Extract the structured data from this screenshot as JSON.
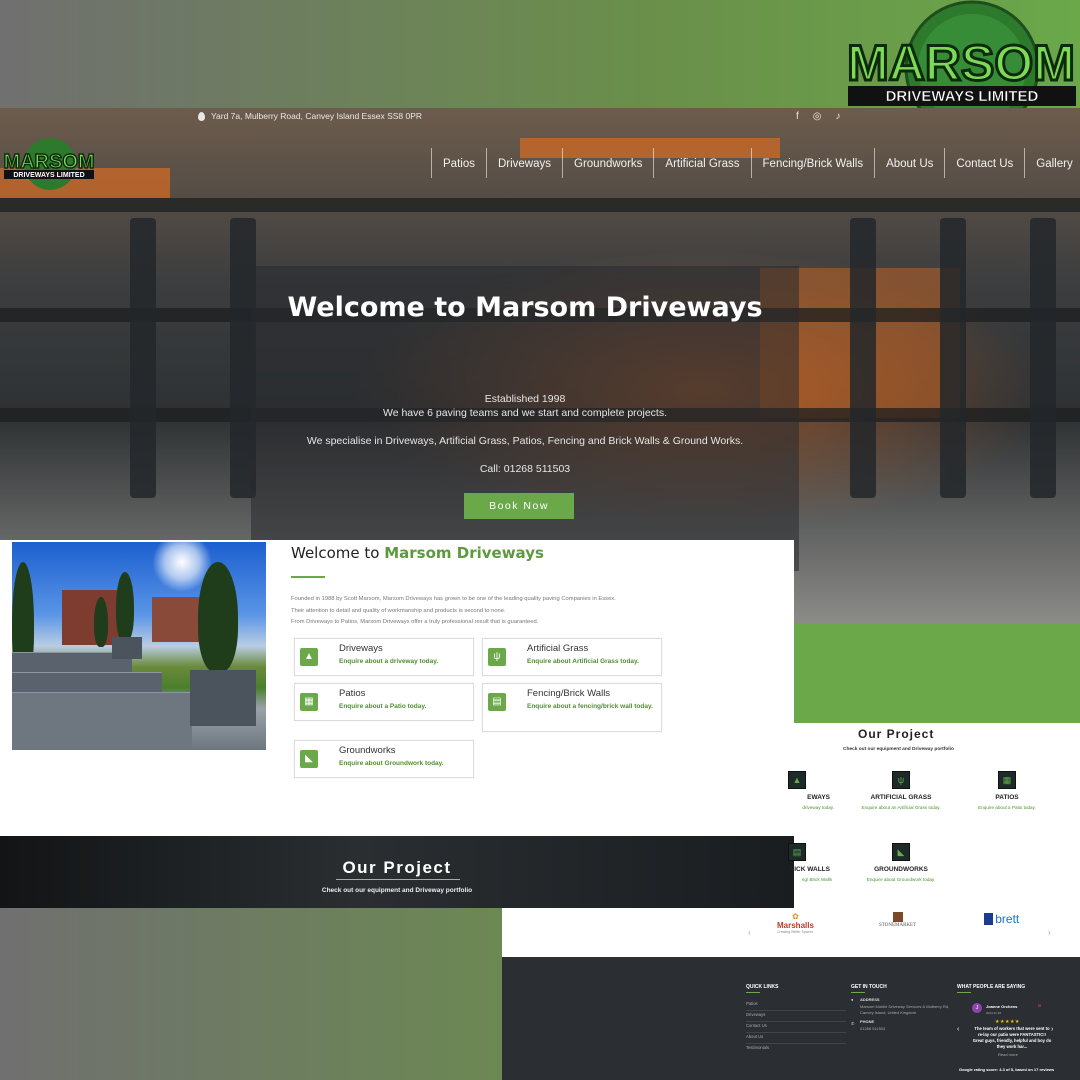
{
  "brand": {
    "name": "MARSOM",
    "tagline": "DRIVEWAYS LIMITED"
  },
  "hero": {
    "address": "Yard 7a, Mulberry Road, Canvey Island Essex SS8 0PR",
    "socials": [
      "f",
      "◎",
      "♪"
    ],
    "nav": [
      "Patios",
      "Driveways",
      "Groundworks",
      "Artificial Grass",
      "Fencing/Brick Walls",
      "About Us",
      "Contact Us",
      "Gallery"
    ],
    "title": "Welcome to Marsom Driveways",
    "established": "Established 1998",
    "teams": "We have 6 paving teams and we start and complete projects.",
    "specialise": "We specialise in Driveways, Artificial Grass, Patios, Fencing and Brick Walls & Ground Works.",
    "call": "Call: 01268 511503",
    "book_label": "Book Now"
  },
  "about": {
    "title_prefix": "Welcome to ",
    "title_highlight": "Marsom Driveways",
    "p1": "Founded in 1988 by Scott Marsom, Marsom Driveways has grown to be one of the leading quality paving Companies in Essex.",
    "p2": "Their attention to detail and quality of workmanship and products is second to none.",
    "p3": "From Driveways to Patios, Marsom Driveways offer a truly professional result that is guaranteed.",
    "services": [
      {
        "title": "Driveways",
        "sub": "Enquire about a driveway today.",
        "icon": "driveway-icon"
      },
      {
        "title": "Artificial Grass",
        "sub": "Enquire about Artificial Grass today.",
        "icon": "grass-icon"
      },
      {
        "title": "Patios",
        "sub": "Enquire about a Patio today.",
        "icon": "patio-icon"
      },
      {
        "title": "Fencing/Brick Walls",
        "sub": "Enquire about a fencing/brick wall today.",
        "icon": "brick-wall-icon"
      },
      {
        "title": "Groundworks",
        "sub": "Enquire about Groundwork today.",
        "icon": "groundworks-icon"
      }
    ]
  },
  "project_banner": {
    "title": "Our Project",
    "sub": "Check out our equipment and Driveway portfolio"
  },
  "project_panel": {
    "title": "Our Project",
    "sub": "Check out our equipment and Driveway portfolio",
    "items": [
      {
        "title": "EWAYS",
        "sub": "driveway today."
      },
      {
        "title": "ARTIFICIAL GRASS",
        "sub": "Enquire about an Artificial Grass today."
      },
      {
        "title": "PATIOS",
        "sub": "Enquire about a Patio today."
      },
      {
        "title": "RICK WALLS",
        "sub": "ng/ Brick Walls"
      },
      {
        "title": "GROUNDWORKS",
        "sub": "Enquire about Groundwork today."
      }
    ],
    "brands": [
      "Marshalls",
      "STONEMARKET",
      "brett"
    ],
    "marshalls_tagline": "Creating Better Spaces"
  },
  "footer": {
    "quick_links_title": "QUICK LINKS",
    "quick_links": [
      "Patios",
      "Driveways",
      "Contact Us",
      "About Us",
      "Testimonials"
    ],
    "get_in_touch_title": "GET IN TOUCH",
    "address_label": "ADDRESS",
    "address_text": "Marsom Mobile Driveway Services & Mulberry Rd, Canvey Island, United Kingdom",
    "phone_label": "PHONE",
    "phone_text": "01268 511503",
    "reviews_title": "WHAT PEOPLE ARE SAYING",
    "reviewer": "Joanne Orchens",
    "reviewer_initial": "J",
    "review_date": "2024-11-26",
    "stars": "★★★★★",
    "review_text": "The team of workers that were sent to re-lay our patio were FANTASTIC!! Great guys, friendly, helpful and boy do they work har...",
    "read_more": "Read more",
    "rating_summary": "Google rating score: 4.3 of 5, based on 17 reviews"
  },
  "colors": {
    "accent": "#6aa84a",
    "dark": "#2b2f33"
  }
}
